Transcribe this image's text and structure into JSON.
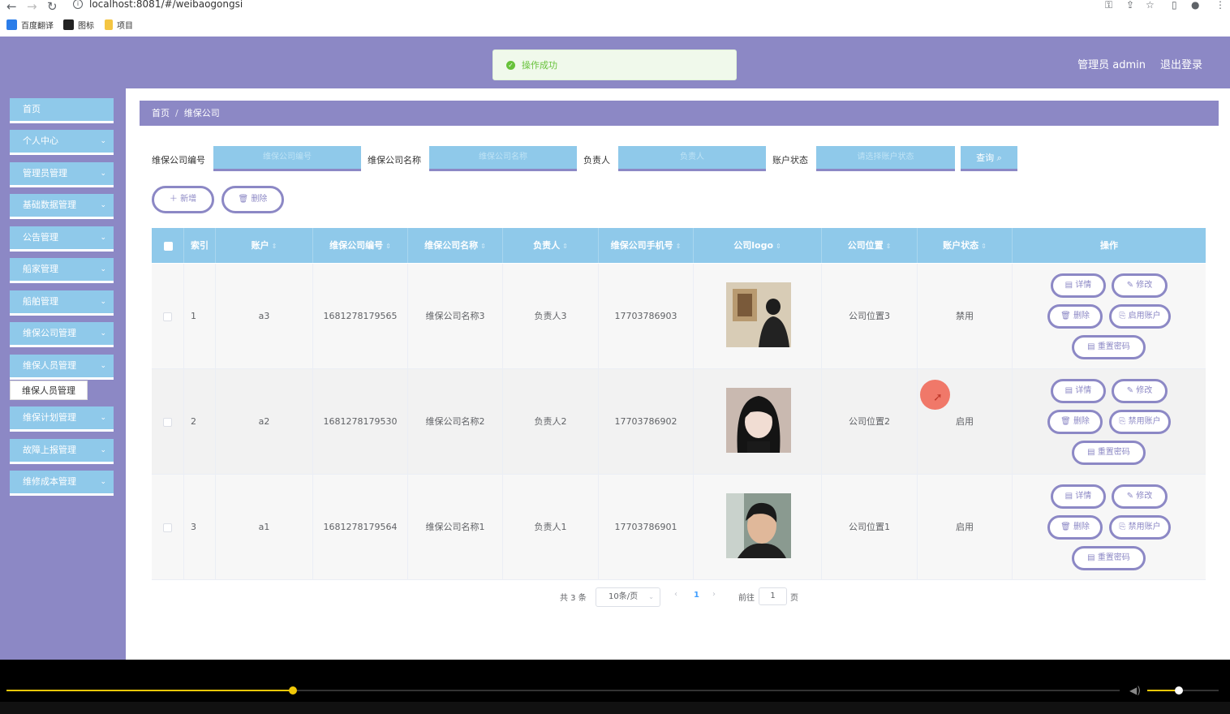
{
  "browser": {
    "url": "localhost:8081/#/weibaogongsi",
    "bookmarks": [
      {
        "label": "百度翻译",
        "color": "#2b7de9"
      },
      {
        "label": "图标",
        "color": "#222222"
      },
      {
        "label": "项目",
        "color": "#f4c542"
      }
    ]
  },
  "header": {
    "user": "管理员 admin",
    "logout": "退出登录",
    "toast": "操作成功"
  },
  "sidebar": {
    "items": [
      {
        "label": "首页",
        "chevron": false
      },
      {
        "label": "个人中心",
        "chevron": true
      },
      {
        "label": "管理员管理",
        "chevron": true
      },
      {
        "label": "基础数据管理",
        "chevron": true
      },
      {
        "label": "公告管理",
        "chevron": true
      },
      {
        "label": "船家管理",
        "chevron": true
      },
      {
        "label": "船舶管理",
        "chevron": true
      },
      {
        "label": "维保公司管理",
        "chevron": true
      },
      {
        "label": "维保人员管理",
        "chevron": true
      },
      {
        "label": "维保计划管理",
        "chevron": true
      },
      {
        "label": "故障上报管理",
        "chevron": true
      },
      {
        "label": "维修成本管理",
        "chevron": true
      }
    ],
    "submenu": "维保人员管理"
  },
  "breadcrumb": {
    "home": "首页",
    "sep": "/",
    "current": "维保公司"
  },
  "filters": {
    "f1_label": "维保公司编号",
    "f1_placeholder": "维保公司编号",
    "f2_label": "维保公司名称",
    "f2_placeholder": "维保公司名称",
    "f3_label": "负责人",
    "f3_placeholder": "负责人",
    "f4_label": "账户状态",
    "f4_placeholder": "请选择账户状态",
    "search": "查询"
  },
  "actions": {
    "add": "新增",
    "delete": "删除"
  },
  "table": {
    "headers": {
      "index": "索引",
      "account": "账户",
      "code": "维保公司编号",
      "name": "维保公司名称",
      "owner": "负责人",
      "phone": "维保公司手机号",
      "logo": "公司logo",
      "location": "公司位置",
      "status": "账户状态",
      "ops": "操作"
    },
    "rows": [
      {
        "index": "1",
        "account": "a3",
        "code": "1681278179565",
        "name": "维保公司名称3",
        "owner": "负责人3",
        "phone": "17703786903",
        "location": "公司位置3",
        "status": "禁用",
        "toggle": "启用账户"
      },
      {
        "index": "2",
        "account": "a2",
        "code": "1681278179530",
        "name": "维保公司名称2",
        "owner": "负责人2",
        "phone": "17703786902",
        "location": "公司位置2",
        "status": "启用",
        "toggle": "禁用账户"
      },
      {
        "index": "3",
        "account": "a1",
        "code": "1681278179564",
        "name": "维保公司名称1",
        "owner": "负责人1",
        "phone": "17703786901",
        "location": "公司位置1",
        "status": "启用",
        "toggle": "禁用账户"
      }
    ],
    "row_actions": {
      "detail": "详情",
      "edit": "修改",
      "delete": "删除",
      "reset": "重置密码"
    }
  },
  "pager": {
    "total": "共 3 条",
    "size": "10条/页",
    "page": "1",
    "goto": "前往",
    "jump": "1",
    "suffix": "页"
  },
  "video": {
    "progress": 0.26,
    "volume": 0.4
  }
}
